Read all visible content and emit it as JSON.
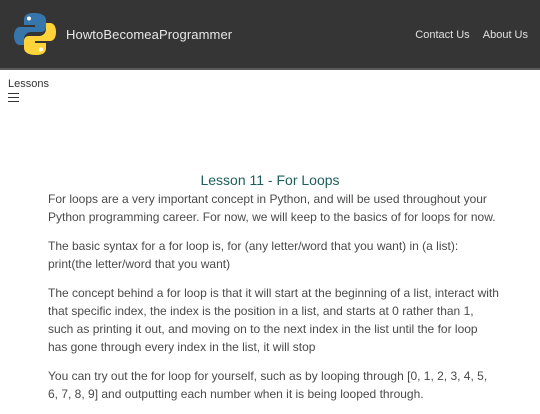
{
  "navbar": {
    "brand": "HowtoBecomeaProgrammer",
    "logo_icon": "python-logo-icon",
    "links": [
      "Contact Us",
      "About Us"
    ],
    "background": "#353535"
  },
  "sidebar": {
    "label": "Lessons",
    "menu_icon": "hamburger-menu-icon"
  },
  "main": {
    "title": "Lesson 11 - For Loops",
    "title_color": "#1c5f5a",
    "paragraphs": [
      "For loops are a very important concept in Python, and will be used throughout your Python programming career. For now, we will keep to the basics of for loops for now.",
      "The basic syntax for a for loop is, for (any letter/word that you want) in (a list): print(the letter/word that you want)",
      "The concept behind a for loop is that it will start at the beginning of a list, interact with that specific index, the index is the position in a list, and starts at 0 rather than 1, such as printing it out, and moving on to the next index in the list until the for loop has gone through every index in the list, it will stop",
      "You can try out the for loop for yourself, such as by looping through [0, 1, 2, 3, 4, 5, 6, 7, 8, 9] and outputting each number when it is being looped through."
    ]
  }
}
